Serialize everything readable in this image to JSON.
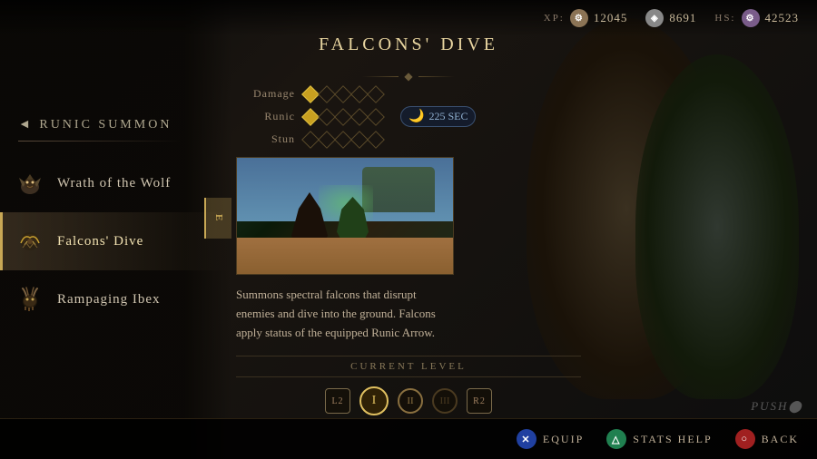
{
  "hud": {
    "xp_label": "XP:",
    "xp_value": "12045",
    "silver_value": "8691",
    "hs_label": "HS:",
    "hs_value": "42523"
  },
  "sidebar": {
    "title": "◄ RUNIC SUMMON",
    "items": [
      {
        "id": "wolf",
        "label": "Wrath of the Wolf",
        "active": false
      },
      {
        "id": "falcons",
        "label": "Falcons' Dive",
        "active": true
      },
      {
        "id": "ibex",
        "label": "Rampaging Ibex",
        "active": false
      }
    ],
    "selected_letter": "E"
  },
  "ability": {
    "title": "FALCONS' DIVE",
    "stats": [
      {
        "label": "Damage",
        "filled": 1,
        "total": 5
      },
      {
        "label": "Runic",
        "filled": 1,
        "total": 5
      },
      {
        "label": "Stun",
        "filled": 0,
        "total": 5
      }
    ],
    "cooldown": "225 SEC",
    "description": "Summons spectral falcons that disrupt enemies and dive into the ground. Falcons apply status of the equipped Runic Arrow.",
    "level_section": {
      "title": "CURRENT LEVEL",
      "levels": [
        "I",
        "II",
        "III"
      ],
      "current_index": 0
    },
    "l2_label": "L2",
    "r2_label": "R2"
  },
  "actions": [
    {
      "id": "equip",
      "label": "EQUIP",
      "button": "✕",
      "color": "btn-x"
    },
    {
      "id": "stats",
      "label": "STATS HELP",
      "button": "△",
      "color": "btn-triangle"
    },
    {
      "id": "back",
      "label": "BACK",
      "button": "○",
      "color": "btn-circle"
    }
  ],
  "push_logo": "PUSH⬤"
}
